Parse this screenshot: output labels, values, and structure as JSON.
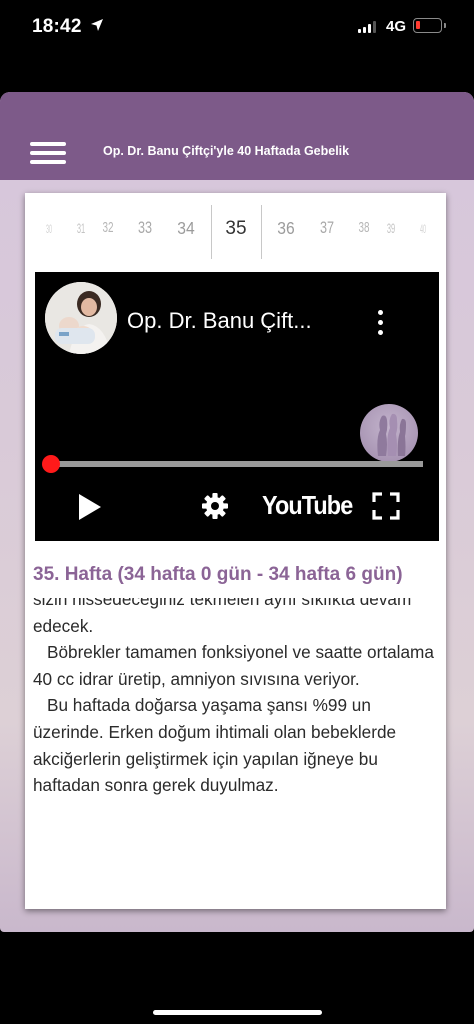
{
  "status_bar": {
    "time": "18:42",
    "location_icon": "location-arrow-icon",
    "network": "4G",
    "battery_level": 0.15,
    "battery_color": "#ff3b30"
  },
  "app": {
    "nav_color": "#7d5a89",
    "title": "Op. Dr. Banu Çiftçi'yle 40 Haftada Gebelik",
    "menu_icon": "hamburger-menu-icon"
  },
  "week_picker": {
    "weeks": [
      "30",
      "31",
      "32",
      "33",
      "34",
      "35",
      "36",
      "37",
      "38",
      "39",
      "40"
    ],
    "selected": "35"
  },
  "video": {
    "title": "Op. Dr. Banu Çift...",
    "progress": 0.0,
    "logo_text": "YouTube",
    "progress_color": "#ff0000"
  },
  "content": {
    "heading": "35. Hafta (34 hafta 0 gün - 34 hafta 6 gün)",
    "heading_color": "#8b6496",
    "paragraphs": [
      "sizin hissedeceğiniz tekmeleri aynı sıklıkta devam edecek.",
      "Böbrekler tamamen fonksiyonel ve saatte ortalama 40 cc idrar üretip, amniyon sıvısına veriyor.",
      "Bu haftada doğarsa yaşama şansı %99 un üzerinde. Erken doğum ihtimali olan bebeklerde akciğerlerin geliştirmek için yapılan iğneye bu haftadan sonra gerek duyulmaz."
    ]
  }
}
